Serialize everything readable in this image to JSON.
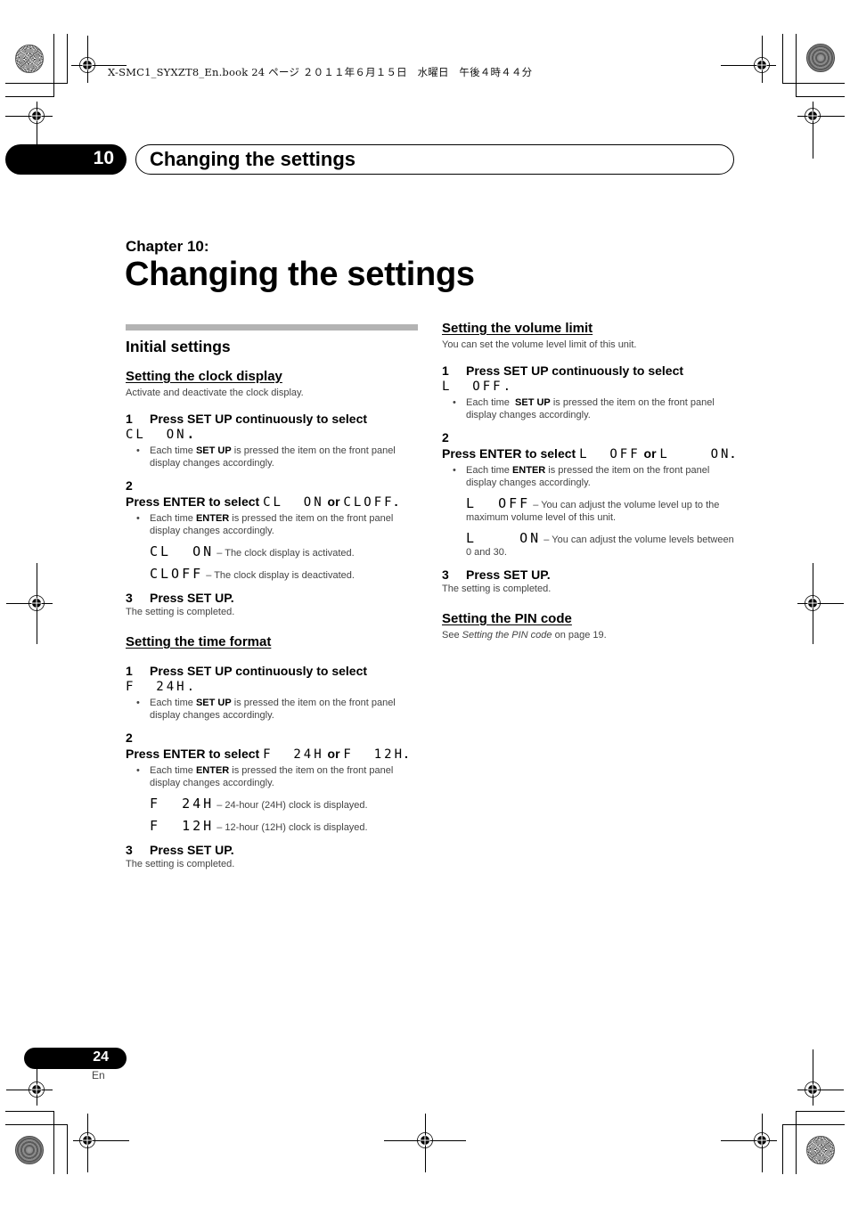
{
  "print_header": {
    "meta_text": "X-SMC1_SYXZT8_En.book  24 ページ  ２０１１年６月１５日　水曜日　午後４時４４分"
  },
  "banner": {
    "chapter_number": "10",
    "title": "Changing the settings"
  },
  "chapter": {
    "label": "Chapter 10:",
    "title": "Changing the settings"
  },
  "left_column": {
    "section_title": "Initial settings",
    "clock_display": {
      "title": "Setting the clock display",
      "intro": "Activate and deactivate the clock display.",
      "step1": {
        "num": "1",
        "text": "Press SET UP continuously to select",
        "display": "CL  ON",
        "suffix": "."
      },
      "step1_bullet": {
        "pre": "Each time ",
        "bold": "SET UP",
        "post": " is pressed the item on the front panel display changes accordingly."
      },
      "step2": {
        "num": "2",
        "text": "Press ENTER to select ",
        "display_a": "CL  ON",
        "or": " or ",
        "display_b": "CLOFF",
        "suffix": "."
      },
      "step2_bullet": {
        "pre": "Each time ",
        "bold": "ENTER",
        "post": " is pressed the item on the front panel display changes accordingly."
      },
      "options": [
        {
          "display": "CL  ON",
          "desc": " – The clock display is activated."
        },
        {
          "display": "CLOFF",
          "desc": " – The clock display is deactivated."
        }
      ],
      "step3": {
        "num": "3",
        "text": "Press SET UP."
      },
      "result": "The setting is completed."
    },
    "time_format": {
      "title": "Setting the time format",
      "step1": {
        "num": "1",
        "text": "Press SET UP continuously to select",
        "display": "F  24H",
        "suffix": "."
      },
      "step1_bullet": {
        "pre": "Each time ",
        "bold": "SET UP",
        "post": " is pressed the item on the front panel display changes accordingly."
      },
      "step2": {
        "num": "2",
        "text": "Press ENTER to select ",
        "display_a": "F  24H",
        "or": " or ",
        "display_b": "F  12H",
        "suffix": "."
      },
      "step2_bullet": {
        "pre": "Each time ",
        "bold": "ENTER",
        "post": " is pressed the item on the front panel display changes accordingly."
      },
      "options": [
        {
          "display": "F  24H",
          "desc": " – 24-hour (24H) clock is displayed."
        },
        {
          "display": "F  12H",
          "desc": " – 12-hour (12H) clock is displayed."
        }
      ],
      "step3": {
        "num": "3",
        "text": "Press SET UP."
      },
      "result": "The setting is completed."
    }
  },
  "right_column": {
    "volume_limit": {
      "title": "Setting the volume limit",
      "intro": "You can set the volume level limit of this unit.",
      "step1": {
        "num": "1",
        "text": "Press SET UP continuously to select",
        "display": "L  OFF",
        "suffix": "."
      },
      "step1_bullet": {
        "pre": "Each time  ",
        "bold": "SET UP",
        "post": " is pressed the item on the front panel display changes accordingly."
      },
      "step2": {
        "num": "2",
        "text": "Press ENTER to select ",
        "display_a": "L  OFF",
        "or": " or ",
        "display_b": "L    ON",
        "suffix": "."
      },
      "step2_bullet": {
        "pre": "Each time ",
        "bold": "ENTER",
        "post": " is pressed the item on the front panel display changes accordingly."
      },
      "options": [
        {
          "display": "L  OFF",
          "desc": " – You can adjust the volume level up to the maximum volume level of this unit."
        },
        {
          "display": "L    ON",
          "desc": " – You can adjust the volume levels between 0 and 30."
        }
      ],
      "step3": {
        "num": "3",
        "text": "Press SET UP."
      },
      "result": "The setting is completed."
    },
    "pin_code": {
      "title": "Setting the PIN code",
      "text_pre": "See ",
      "text_italic": "Setting the PIN code",
      "text_post": " on page 19."
    }
  },
  "footer": {
    "page_number": "24",
    "language": "En"
  }
}
